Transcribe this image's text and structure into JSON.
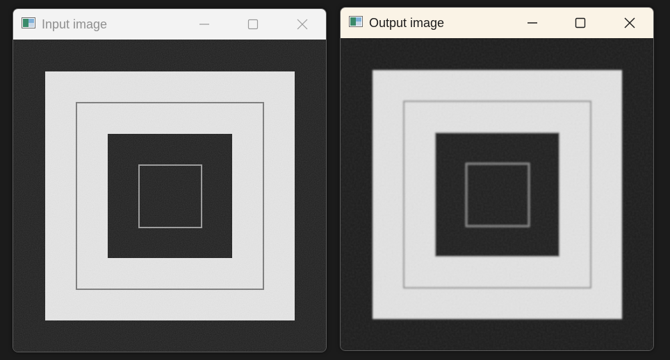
{
  "windows": {
    "input": {
      "title": "Input image",
      "state": "inactive",
      "controls": {
        "minimize": "minimize-icon",
        "maximize": "maximize-icon",
        "close": "close-icon"
      }
    },
    "output": {
      "title": "Output image",
      "state": "active",
      "controls": {
        "minimize": "minimize-icon",
        "maximize": "maximize-icon",
        "close": "close-icon"
      }
    }
  },
  "colors": {
    "desktop": "#1b1b1b",
    "image_dark": "#1e1e1e",
    "image_light": "#e4e4e4",
    "inactive_titlebar": "#f3f3f3",
    "active_titlebar": "#faf3e6",
    "inactive_title_text": "#8f8f8f",
    "active_title_text": "#1a1a1a"
  }
}
